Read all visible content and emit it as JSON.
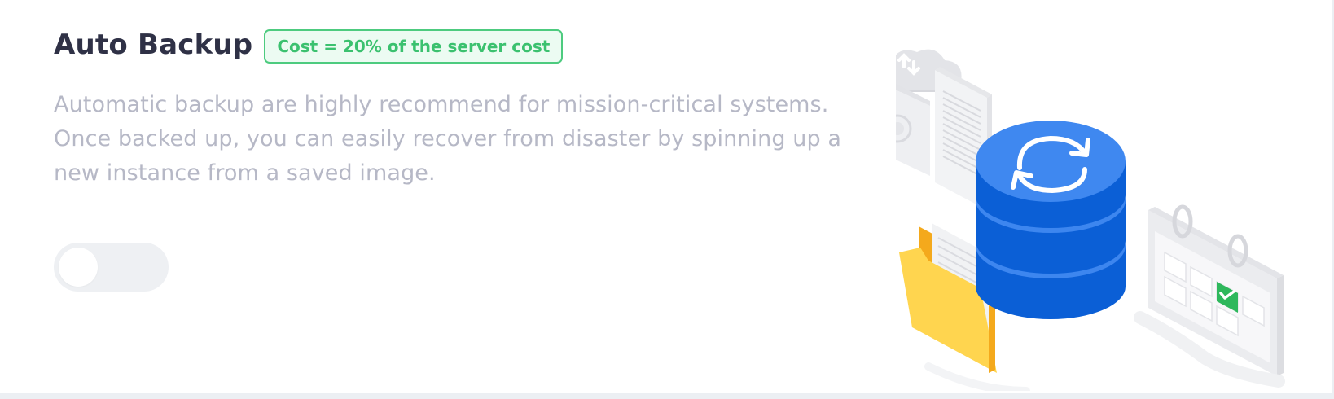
{
  "section": {
    "title": "Auto Backup",
    "cost_badge": "Cost = 20% of the server cost",
    "description": "Automatic backup are highly recommend for mission-critical systems. Once backed up, you can easily recover from disaster by spinning up a new instance from a saved image."
  },
  "toggle": {
    "enabled": false
  },
  "illustration": {
    "icons": [
      "cloud-sync-icon",
      "document-icon",
      "database-sync-icon",
      "folder-icon",
      "calendar-check-icon"
    ]
  },
  "colors": {
    "title": "#2f3146",
    "badge_text": "#3bc16f",
    "badge_border": "#4dcb7f",
    "badge_bg": "#ecfbf2",
    "description": "#b6b8c6",
    "toggle_off": "#eef0f3",
    "database_blue": "#1f6fe5",
    "folder_yellow": "#ffd54f",
    "check_green": "#2eb85c"
  }
}
